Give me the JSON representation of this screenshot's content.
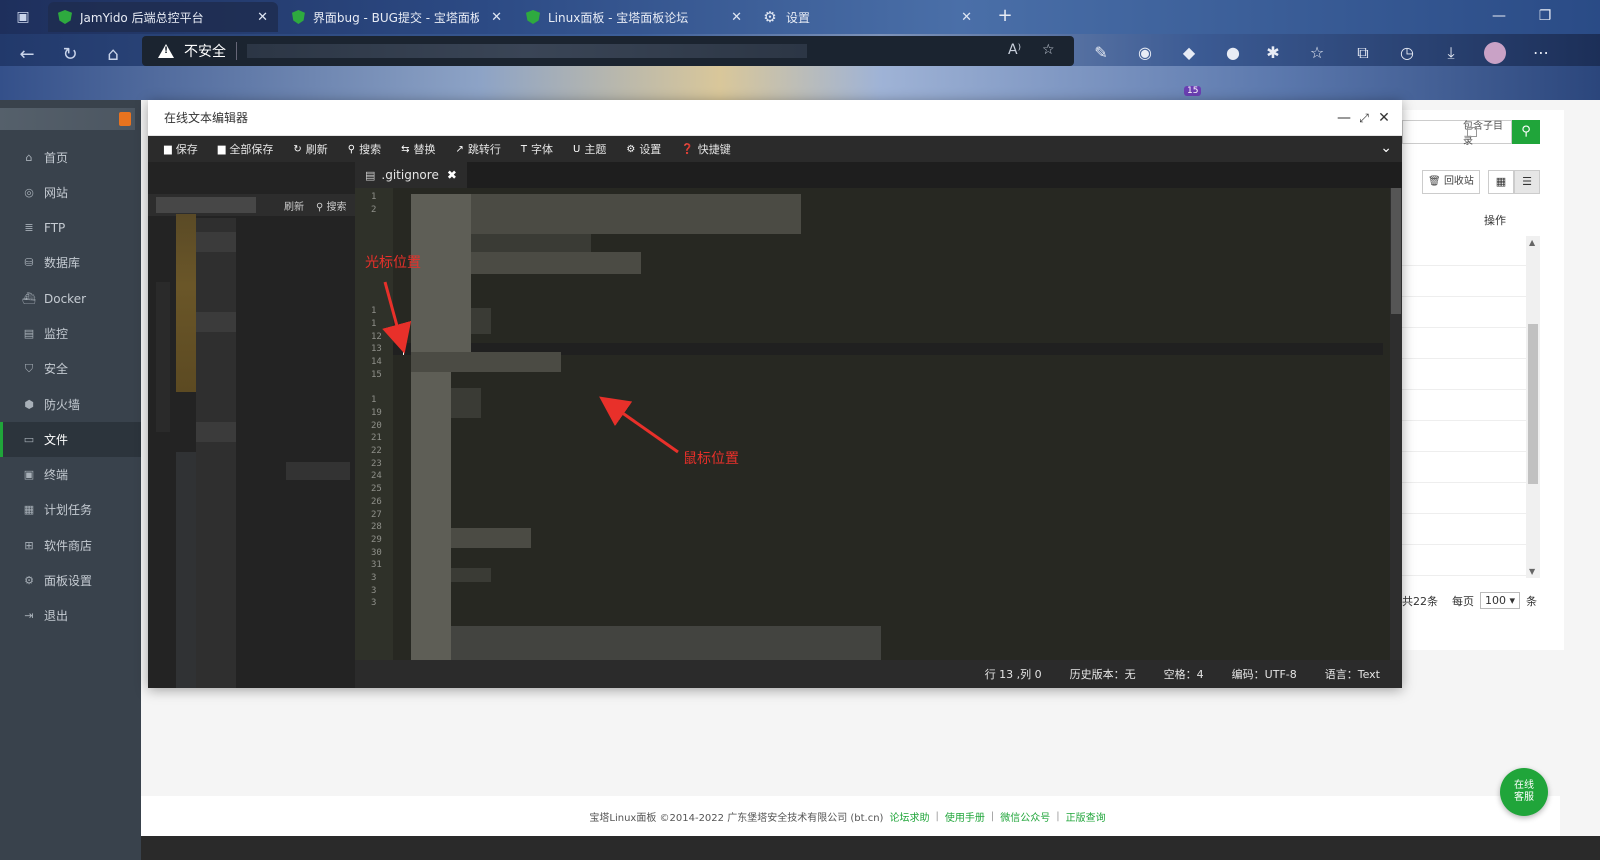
{
  "browser": {
    "tabs": [
      {
        "title": "JamYido 后端总控平台",
        "icon": "shield-icon"
      },
      {
        "title": "界面bug - BUG提交 - 宝塔面板论",
        "icon": "shield-icon"
      },
      {
        "title": "Linux面板 - 宝塔面板论坛",
        "icon": "shield-icon"
      },
      {
        "title": "设置",
        "icon": "gear-icon"
      }
    ],
    "address": {
      "security_label": "不安全"
    },
    "extension_badge": "15"
  },
  "sidebar": {
    "items": [
      {
        "label": "首页",
        "icon": "home-icon"
      },
      {
        "label": "网站",
        "icon": "globe-icon"
      },
      {
        "label": "FTP",
        "icon": "ftp-icon"
      },
      {
        "label": "数据库",
        "icon": "database-icon"
      },
      {
        "label": "Docker",
        "icon": "docker-icon"
      },
      {
        "label": "监控",
        "icon": "monitor-icon"
      },
      {
        "label": "安全",
        "icon": "shield-icon"
      },
      {
        "label": "防火墙",
        "icon": "firewall-icon"
      },
      {
        "label": "文件",
        "icon": "folder-icon",
        "active": true
      },
      {
        "label": "终端",
        "icon": "terminal-icon"
      },
      {
        "label": "计划任务",
        "icon": "calendar-icon"
      },
      {
        "label": "软件商店",
        "icon": "apps-icon"
      },
      {
        "label": "面板设置",
        "icon": "settings-icon"
      },
      {
        "label": "退出",
        "icon": "logout-icon"
      }
    ]
  },
  "background_panel": {
    "include_subdir": "包含子目录",
    "recycle_bin": "回收站",
    "operation_header": "操作",
    "total": "共22条",
    "per_page_label": "每页",
    "per_page_value": "100",
    "unit": "条"
  },
  "footer": {
    "copyright": "宝塔Linux面板 ©2014-2022 广东堡塔安全技术有限公司 (bt.cn)",
    "links": [
      "论坛求助",
      "使用手册",
      "微信公众号",
      "正版查询"
    ]
  },
  "online_service": "在线客服",
  "editor": {
    "title": "在线文本编辑器",
    "toolbar": [
      {
        "label": "保存",
        "icon": "save-icon"
      },
      {
        "label": "全部保存",
        "icon": "save-all-icon"
      },
      {
        "label": "刷新",
        "icon": "refresh-icon"
      },
      {
        "label": "搜索",
        "icon": "search-icon"
      },
      {
        "label": "替换",
        "icon": "replace-icon"
      },
      {
        "label": "跳转行",
        "icon": "goto-icon"
      },
      {
        "label": "字体",
        "icon": "font-icon"
      },
      {
        "label": "主题",
        "icon": "theme-icon"
      },
      {
        "label": "设置",
        "icon": "gear-icon"
      },
      {
        "label": "快捷键",
        "icon": "keyboard-icon"
      }
    ],
    "tree": {
      "refresh": "刷新",
      "search": "搜索"
    },
    "file_tab": ".gitignore",
    "line_numbers": [
      "1",
      "2",
      "",
      "",
      "",
      "",
      "",
      "",
      "",
      "1",
      "1",
      "12",
      "13",
      "14",
      "15",
      "",
      "1",
      "19",
      "20",
      "21",
      "22",
      "23",
      "24",
      "25",
      "26",
      "27",
      "28",
      "29",
      "30",
      "31",
      "3",
      "3",
      "3"
    ],
    "status": {
      "position": "行 13 ,列 0",
      "history": "历史版本：无",
      "indent": "空格：4",
      "encoding": "编码：UTF-8",
      "language": "语言：Text"
    }
  },
  "annotations": {
    "cursor_label": "光标位置",
    "mouse_label": "鼠标位置",
    "color": "#e8302a"
  }
}
